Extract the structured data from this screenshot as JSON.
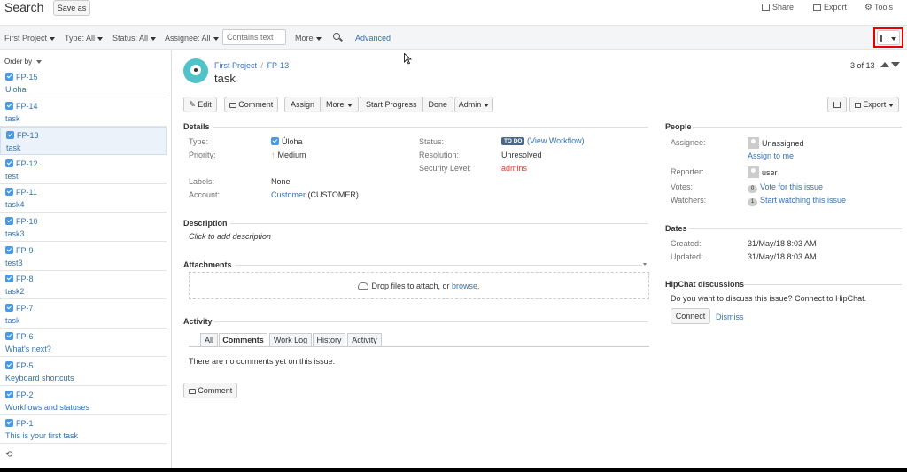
{
  "header": {
    "title": "Search",
    "save_as": "Save as",
    "share": "Share",
    "export": "Export",
    "tools": "Tools"
  },
  "filters": {
    "project": "First Project",
    "type": "Type: All",
    "status": "Status: All",
    "assignee": "Assignee: All",
    "text_placeholder": "Contains text",
    "more": "More",
    "advanced": "Advanced"
  },
  "sidebar": {
    "order_by": "Order by",
    "items": [
      {
        "key": "FP-15",
        "summary": "Uloha"
      },
      {
        "key": "FP-14",
        "summary": "task"
      },
      {
        "key": "FP-13",
        "summary": "task"
      },
      {
        "key": "FP-12",
        "summary": "test"
      },
      {
        "key": "FP-11",
        "summary": "task4"
      },
      {
        "key": "FP-10",
        "summary": "task3"
      },
      {
        "key": "FP-9",
        "summary": "test3"
      },
      {
        "key": "FP-8",
        "summary": "task2"
      },
      {
        "key": "FP-7",
        "summary": "task"
      },
      {
        "key": "FP-6",
        "summary": "What's next?"
      },
      {
        "key": "FP-5",
        "summary": "Keyboard shortcuts"
      },
      {
        "key": "FP-2",
        "summary": "Workflows and statuses"
      },
      {
        "key": "FP-1",
        "summary": "This is your first task"
      }
    ]
  },
  "issue": {
    "breadcrumb_project": "First Project",
    "breadcrumb_sep": "/",
    "key": "FP-13",
    "title": "task",
    "pager": "3 of 13"
  },
  "actions": {
    "edit": "Edit",
    "comment": "Comment",
    "assign": "Assign",
    "more": "More",
    "start_progress": "Start Progress",
    "done": "Done",
    "admin": "Admin",
    "export": "Export"
  },
  "details": {
    "title": "Details",
    "type_label": "Type:",
    "type_value": "Úloha",
    "priority_label": "Priority:",
    "priority_value": "Medium",
    "labels_label": "Labels:",
    "labels_value": "None",
    "account_label": "Account:",
    "account_link": "Customer",
    "account_rest": "(CUSTOMER)",
    "status_label": "Status:",
    "status_badge": "TO DO",
    "status_link": "(View Workflow)",
    "resolution_label": "Resolution:",
    "resolution_value": "Unresolved",
    "security_label": "Security Level:",
    "security_value": "admins"
  },
  "description": {
    "title": "Description",
    "placeholder": "Click to add description"
  },
  "attachments": {
    "title": "Attachments",
    "drop_text": "Drop files to attach, or",
    "browse": "browse."
  },
  "activity": {
    "title": "Activity",
    "tabs": [
      "All",
      "Comments",
      "Work Log",
      "History",
      "Activity"
    ],
    "empty": "There are no comments yet on this issue.",
    "comment_button": "Comment"
  },
  "people": {
    "title": "People",
    "assignee_label": "Assignee:",
    "assignee_value": "Unassigned",
    "assign_to_me": "Assign to me",
    "reporter_label": "Reporter:",
    "reporter_value": "user",
    "votes_label": "Votes:",
    "votes_count": "0",
    "vote_link": "Vote for this issue",
    "watchers_label": "Watchers:",
    "watchers_count": "1",
    "watch_link": "Start watching this issue"
  },
  "dates": {
    "title": "Dates",
    "created_label": "Created:",
    "created_value": "31/May/18 8:03 AM",
    "updated_label": "Updated:",
    "updated_value": "31/May/18 8:03 AM"
  },
  "hipchat": {
    "title": "HipChat discussions",
    "text": "Do you want to discuss this issue? Connect to HipChat.",
    "connect": "Connect",
    "dismiss": "Dismiss"
  },
  "colors": {
    "link": "#3572b0",
    "status_badge": "#4a6785",
    "security": "#d04437",
    "highlight": "#e60000"
  }
}
